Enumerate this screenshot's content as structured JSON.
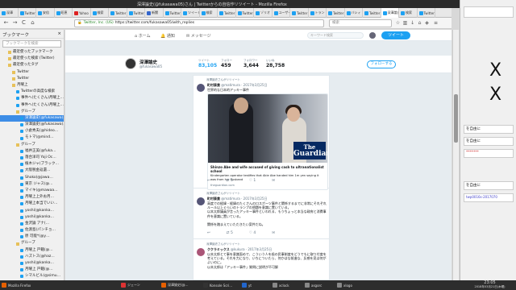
{
  "window": {
    "title": "深澤論史(@fukasawa05)さん | Twitterからの自信作リツイート - Mozilla Firefox"
  },
  "tabs": [
    {
      "label": "深澤",
      "color": "tw"
    },
    {
      "label": "Twitter",
      "color": "tw"
    },
    {
      "label": "安倍",
      "color": "tw"
    },
    {
      "label": "昭恵",
      "color": "tw"
    },
    {
      "label": "Yahoo",
      "color": "red"
    },
    {
      "label": "検索",
      "color": "tw"
    },
    {
      "label": "Twitter",
      "color": "tw"
    },
    {
      "label": "Twitter",
      "color": "tw"
    },
    {
      "label": "新聞",
      "color": "blue"
    },
    {
      "label": "Twitter",
      "color": "tw"
    },
    {
      "label": "ツイート",
      "color": "tw"
    },
    {
      "label": "検索",
      "color": "tw"
    },
    {
      "label": "Twitter",
      "color": "tw"
    },
    {
      "label": "Twitter",
      "color": "tw"
    },
    {
      "label": "ゾリオ",
      "color": "tw"
    },
    {
      "label": "ユーザー",
      "color": "tw"
    },
    {
      "label": "Twitter",
      "color": "tw"
    },
    {
      "label": "トラン",
      "color": "tw"
    },
    {
      "label": "Twitter",
      "color": "tw"
    },
    {
      "label": "バシィ",
      "color": "tw"
    },
    {
      "label": "Twitter",
      "color": "tw"
    },
    {
      "label": "深澤論史",
      "color": "tw"
    },
    {
      "label": "検索",
      "color": "tw"
    },
    {
      "label": "Twitter",
      "color": "tw"
    }
  ],
  "navbar": {
    "back": "←",
    "forward": "→",
    "reload": "C",
    "home": "⌂",
    "site_label": "Twitter, Inc. (US)",
    "url": "https://twitter.com/fukasawa05/with_replies",
    "search_placeholder": "検索"
  },
  "sidebar": {
    "title": "ブックマーク",
    "close": "×",
    "search_placeholder": "ブックマークを検索",
    "items": [
      {
        "label": "最近使ったブックマーク",
        "icon": "folder",
        "indent": 2
      },
      {
        "label": "最近使った検索 (Twitter)",
        "icon": "folder",
        "indent": 2
      },
      {
        "label": "最近使ったタグ",
        "icon": "folder",
        "indent": 2
      },
      {
        "label": "Twitter",
        "icon": "folder",
        "indent": 3
      },
      {
        "label": "Twitter",
        "icon": "folder",
        "indent": 3
      },
      {
        "label": "月曜上",
        "icon": "folder",
        "indent": 3
      },
      {
        "label": "Twitterの高度な検索",
        "icon": "tw",
        "indent": 4
      },
      {
        "label": "事件へ(たくさん)月曜上…",
        "icon": "tw",
        "indent": 4
      },
      {
        "label": "事件へ(たくさん)月曜上…",
        "icon": "tw",
        "indent": 4
      },
      {
        "label": "グループ",
        "icon": "folder",
        "indent": 4
      },
      {
        "label": "深澤論史(@fukasawa)…",
        "icon": "tw",
        "indent": 5,
        "selected": true
      },
      {
        "label": "深澤論史(@fukasawa)…",
        "icon": "tw",
        "indent": 5
      },
      {
        "label": "小倉秀夫(@hideo…",
        "icon": "tw",
        "indent": 5
      },
      {
        "label": "モトマ(@mind…",
        "icon": "tw",
        "indent": 5
      },
      {
        "label": "グループ",
        "icon": "folder",
        "indent": 4
      },
      {
        "label": "福井正美(@fuka…",
        "icon": "tw",
        "indent": 5
      },
      {
        "label": "落合洋司 Yoji Oc…",
        "icon": "tw",
        "indent": 5
      },
      {
        "label": "植木ジャ(ブラック…",
        "icon": "tw",
        "indent": 5
      },
      {
        "label": "大阪税金返還…",
        "icon": "tw",
        "indent": 5
      },
      {
        "label": "Shoko(@jawa…",
        "icon": "tw",
        "indent": 5
      },
      {
        "label": "東京 ジャス(@…",
        "icon": "tw",
        "indent": 5
      },
      {
        "label": "マイキ(@mawaa…",
        "icon": "tw",
        "indent": 5
      },
      {
        "label": "月曜上上外お月…",
        "icon": "tw",
        "indent": 5
      },
      {
        "label": "月曜上本当でいい…",
        "icon": "tw",
        "indent": 5
      },
      {
        "label": "yoshi(@kanka…",
        "icon": "tw",
        "indent": 5
      },
      {
        "label": "yoshi(@kanka…",
        "icon": "tw",
        "indent": 5
      },
      {
        "label": "金沢論 アナ(…",
        "icon": "tw",
        "indent": 5
      },
      {
        "label": "佐渡島(パンチョ…",
        "icon": "tw",
        "indent": 5
      },
      {
        "label": "原 可能*(@y…",
        "icon": "tw",
        "indent": 5
      },
      {
        "label": "グループ",
        "icon": "folder",
        "indent": 4
      },
      {
        "label": "月曜上 戸籍(@…",
        "icon": "tw",
        "indent": 5
      },
      {
        "label": "ハズトス(@haz…",
        "icon": "tw",
        "indent": 5
      },
      {
        "label": "yoshi(@kanka…",
        "icon": "tw",
        "indent": 5
      },
      {
        "label": "月曜上 戸籍(@…",
        "icon": "tw",
        "indent": 5
      },
      {
        "label": "シマルビル(@simu…",
        "icon": "tw",
        "indent": 5
      },
      {
        "label": "深澤論史(@fuka…",
        "icon": "tw",
        "indent": 5
      },
      {
        "label": "月曜上本当月曜…",
        "icon": "tw",
        "indent": 5
      },
      {
        "label": "戸籍上 ルビー(…",
        "icon": "tw",
        "indent": 5
      }
    ]
  },
  "twitter": {
    "nav": {
      "home": "ホーム",
      "notifications": "通知",
      "messages": "メッセージ",
      "search_placeholder": "キーワード検索",
      "tweet_button": "ツイート"
    },
    "profile": {
      "name": "深澤諭史",
      "handle": "@fukasawa05",
      "stats": [
        {
          "label": "ツイート",
          "value": "83,105",
          "active": true
        },
        {
          "label": "フォロー",
          "value": "459"
        },
        {
          "label": "フォロワー",
          "value": "3,644"
        },
        {
          "label": "いいね",
          "value": "28,758"
        }
      ],
      "follow_button": "フォローする"
    },
    "tweets": [
      {
        "rt_note": "深澤諭史さんがリツイート",
        "name": "町村泰貴",
        "handle": "@matimura · 2017年3月25日",
        "text": "世界的な日本的アッキー事件",
        "card": {
          "title": "Shinzo Abe and wife accused of giving cash to ultranationalist school",
          "desc": "Kindergarten operator testifies that Akie Abe handed him 1m yen saying it was from her husband",
          "domain": "theguardian.com",
          "logo_line1": "The",
          "logo_line2": "Guardian"
        },
        "reply": "↩",
        "retweets": "5",
        "likes": "1",
        "more": "✉"
      },
      {
        "rt_note": "深澤諭史さんがリツイート",
        "name": "町村泰貴",
        "handle": "@matimura · 2017年3月25日",
        "text": "高度での経緯・経緯のたくさんの口スポーツ事件と関係するまでに非常にそれぞれルール以上ぐらいのトランプの問題を意識に置いている。\n以本太郎議員が言ったアッキー事件といわれる、もうちょっと本当な政府と消費事件を意識に置いている。\n\n関係を踏まえていただきたい案件だね。",
        "reply": "↩",
        "retweets": "5",
        "likes": "4",
        "more": "✉"
      },
      {
        "rt_note": "深澤諭史さんがリツイート",
        "name": "ククラミックス",
        "handle": "@kukura · 2017年3月25日",
        "text": "以本太郎とて事を意識面めで、こういう人を殺の民事制度をどうでもに取り付度を考えている。それを力になり、いちについたら、何かはな前進な、反感を見は何がよいのに。\n以本太郎は「アッキー事件」質問に説明が不可解"
      }
    ]
  },
  "right_pane": {
    "box1": "を自由に",
    "box2": "を自由に",
    "box3": "*******",
    "box4": "を自由に",
    "box5": "twp0016s-2017070"
  },
  "taskbar": {
    "items": [
      {
        "label": "Mozilla Firefox",
        "color": "#e66000"
      },
      {
        "label": "ジェーン",
        "color": "#dd3333"
      },
      {
        "label": "深澤諭史(@…",
        "color": "#e66000"
      },
      {
        "label": "Konsole Scri…",
        "color": "#333333"
      },
      {
        "label": "yt",
        "color": "#2266cc"
      },
      {
        "label": "xclock",
        "color": "#888888"
      },
      {
        "label": "asgorc",
        "color": "#888888"
      },
      {
        "label": "xlogo",
        "color": "#888888"
      }
    ],
    "time": "23:05",
    "date": "2018年03月21日(木曜)"
  }
}
